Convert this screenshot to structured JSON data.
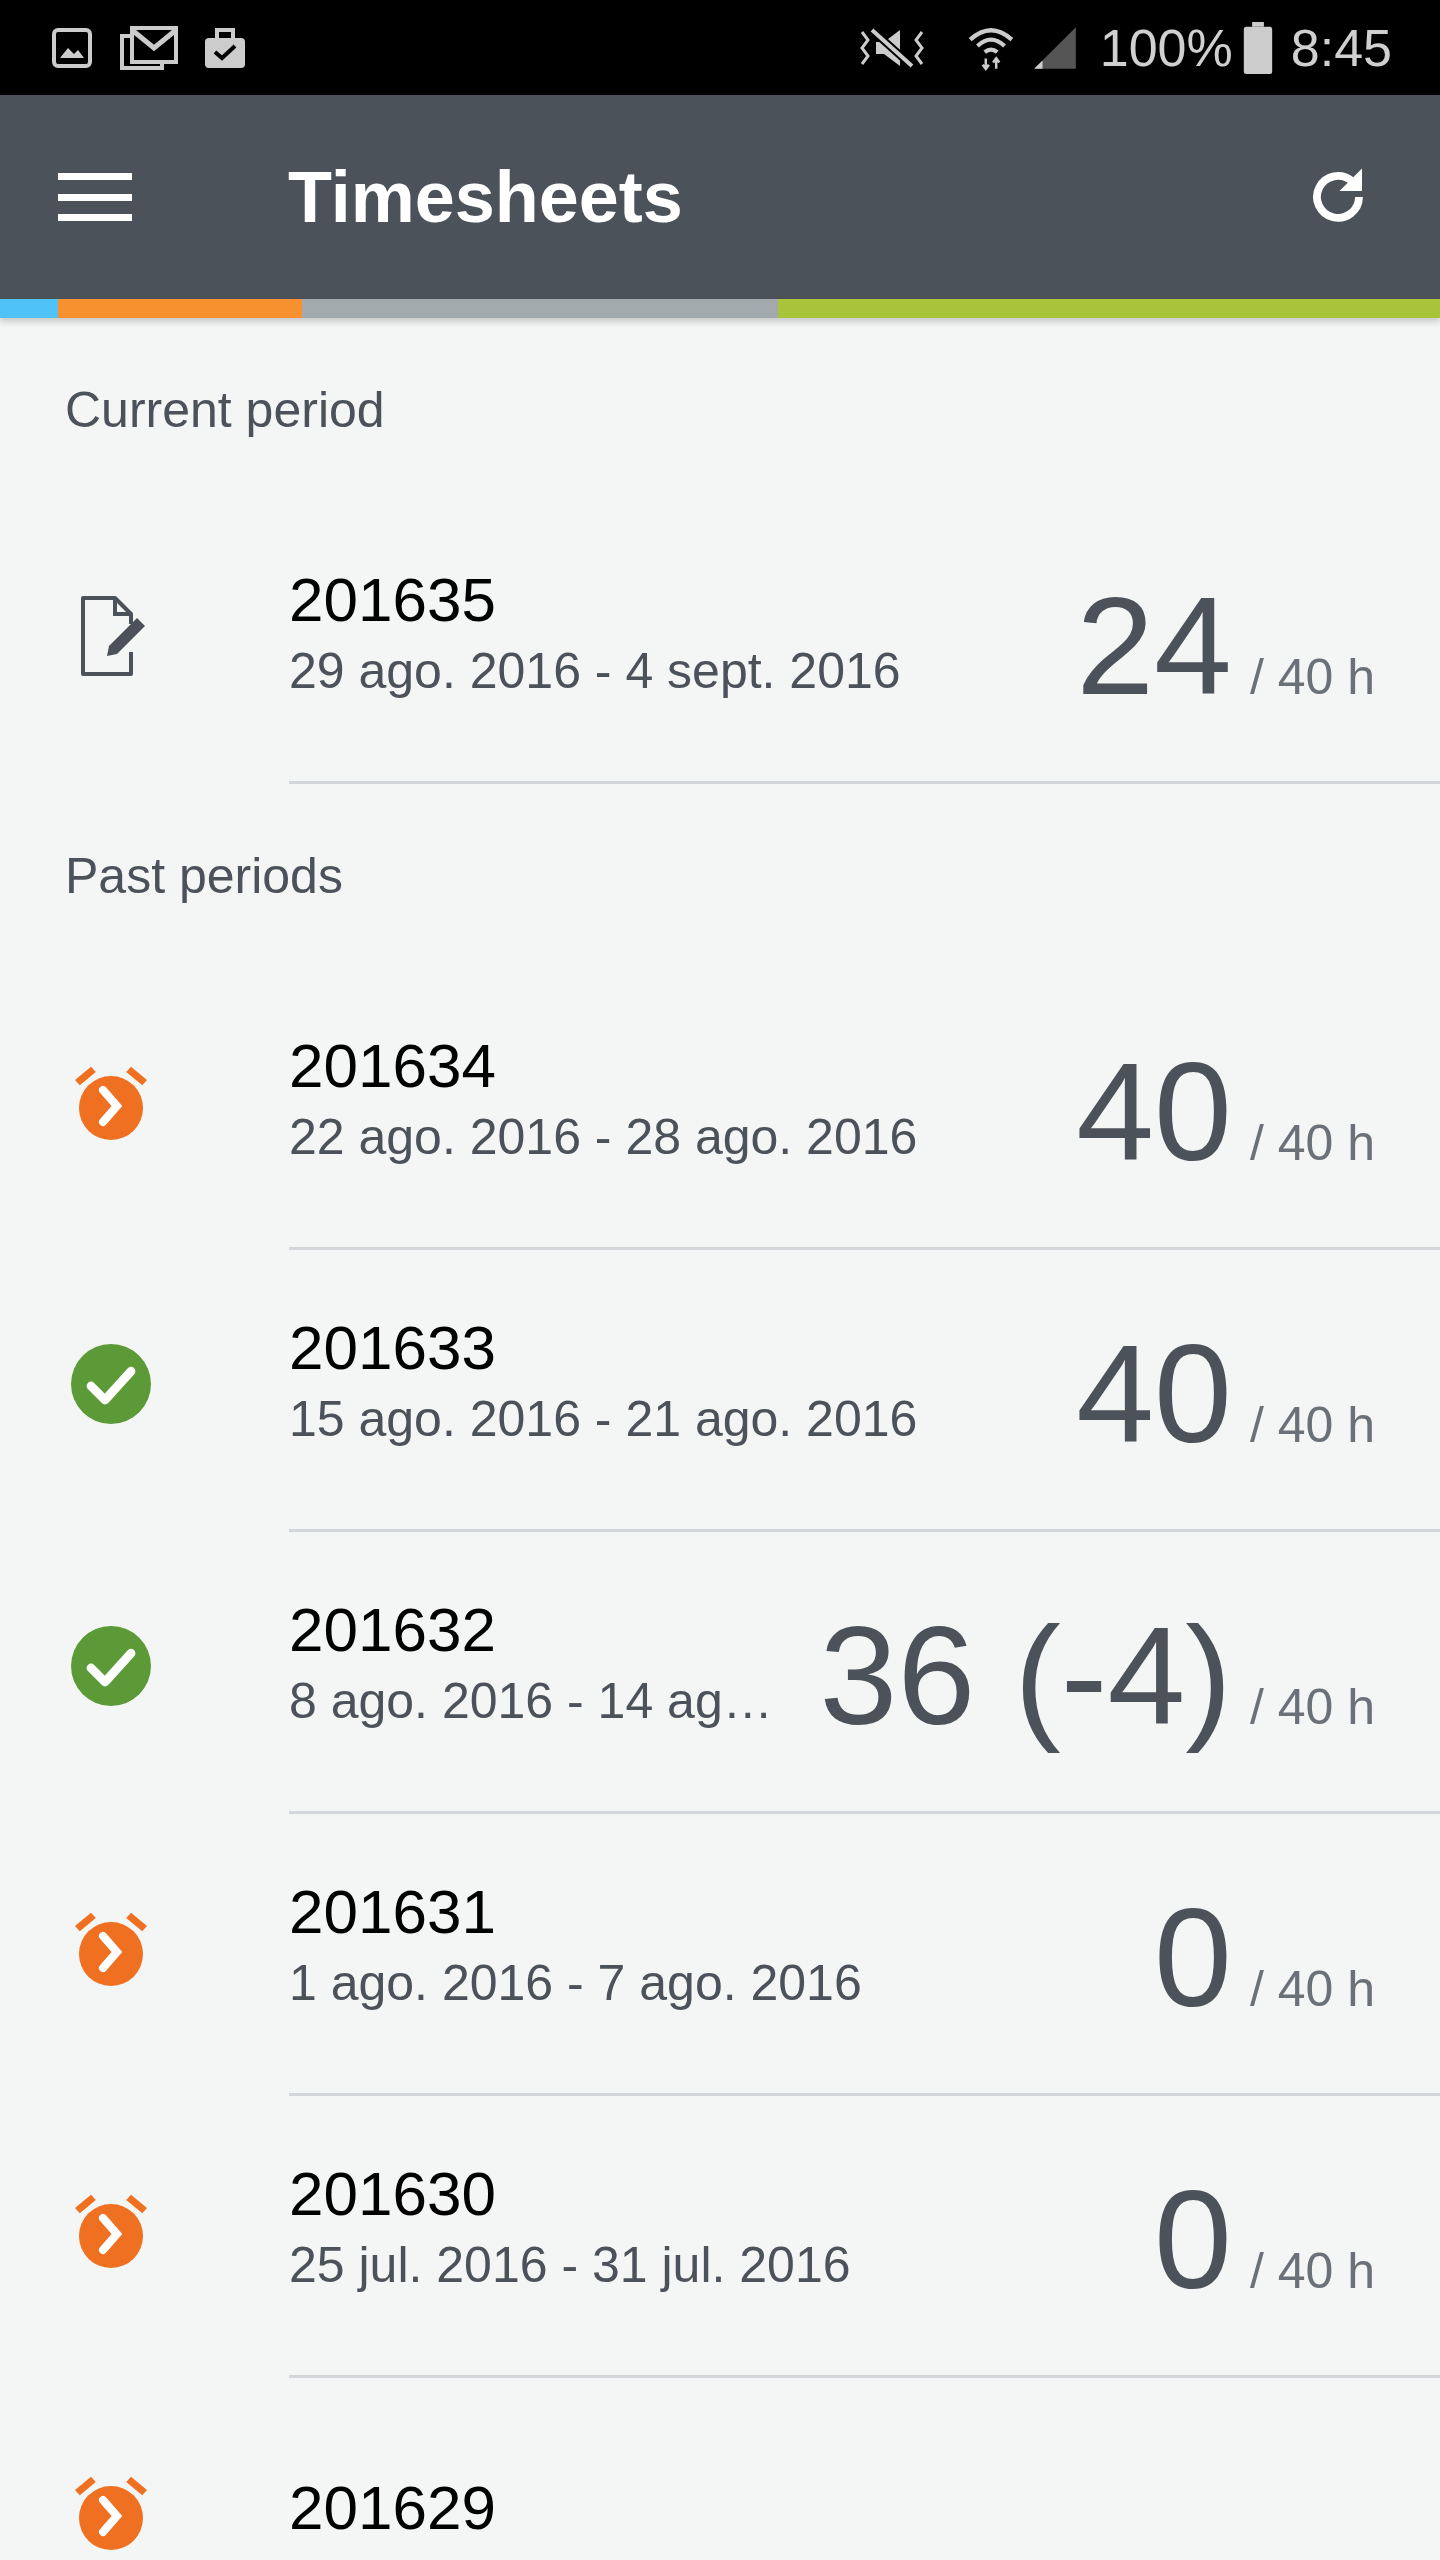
{
  "status_bar": {
    "battery": "100%",
    "time": "8:45"
  },
  "app_bar": {
    "title": "Timesheets"
  },
  "stripe": [
    {
      "color": "#4fc3f7",
      "level": 0.04
    },
    {
      "color": "#f7912f",
      "level": 0.17
    },
    {
      "color": "#a3aaae",
      "level": 0.33
    },
    {
      "color": "#a8c43a",
      "level": 0.46
    }
  ],
  "sections": [
    {
      "title": "Current period",
      "rows": [
        {
          "kind": "draft",
          "code": "201635",
          "dates": "29 ago. 2016 - 4 sept. 2016",
          "hours": "24",
          "target": "/ 40 h"
        }
      ]
    },
    {
      "title": "Past periods",
      "rows": [
        {
          "kind": "pending",
          "code": "201634",
          "dates": "22 ago. 2016 - 28 ago. 2016",
          "hours": "40",
          "target": "/ 40 h"
        },
        {
          "kind": "approved",
          "code": "201633",
          "dates": "15 ago. 2016 - 21 ago. 2016",
          "hours": "40",
          "target": "/ 40 h"
        },
        {
          "kind": "approved",
          "code": "201632",
          "dates": "8 ago. 2016 - 14 ag…",
          "hours": "36 (-4)",
          "target": "/ 40 h"
        },
        {
          "kind": "pending",
          "code": "201631",
          "dates": "1 ago. 2016 - 7 ago. 2016",
          "hours": "0",
          "target": "/ 40 h"
        },
        {
          "kind": "pending",
          "code": "201630",
          "dates": "25 jul. 2016 - 31 jul. 2016",
          "hours": "0",
          "target": "/ 40 h"
        },
        {
          "kind": "pending",
          "code": "201629"
        }
      ]
    }
  ]
}
